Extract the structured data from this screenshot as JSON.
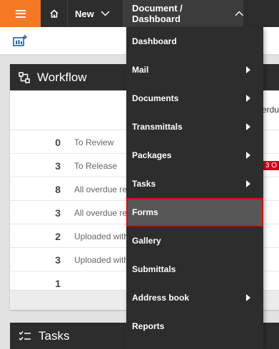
{
  "topbar": {
    "new_label": "New",
    "section_label": "Document / Dashboard"
  },
  "workflow": {
    "title": "Workflow",
    "overdue_header": "Overdu",
    "rows": [
      {
        "count": "0",
        "label": "To Review",
        "badge": ""
      },
      {
        "count": "3",
        "label": "To Release",
        "badge": "3 O"
      },
      {
        "count": "8",
        "label": "All overdue re",
        "badge": ""
      },
      {
        "count": "3",
        "label": "All overdue re",
        "badge": ""
      },
      {
        "count": "2",
        "label": "Uploaded with",
        "badge": ""
      },
      {
        "count": "3",
        "label": "Uploaded with",
        "badge": ""
      },
      {
        "count": "1",
        "label": "",
        "badge": ""
      }
    ]
  },
  "tasks": {
    "title": "Tasks"
  },
  "menu": {
    "items": [
      {
        "label": "Dashboard",
        "submenu": false
      },
      {
        "label": "Mail",
        "submenu": true
      },
      {
        "label": "Documents",
        "submenu": true
      },
      {
        "label": "Transmittals",
        "submenu": true
      },
      {
        "label": "Packages",
        "submenu": true
      },
      {
        "label": "Tasks",
        "submenu": true
      },
      {
        "label": "Forms",
        "submenu": false,
        "selected": true
      },
      {
        "label": "Gallery",
        "submenu": false
      },
      {
        "label": "Submittals",
        "submenu": false
      },
      {
        "label": "Address book",
        "submenu": true
      },
      {
        "label": "Reports",
        "submenu": false
      }
    ]
  },
  "colors": {
    "brand_orange": "#f47920",
    "dark_bar": "#2d2d2d",
    "highlight_red": "#e30613",
    "badge_red": "#d0021b"
  }
}
